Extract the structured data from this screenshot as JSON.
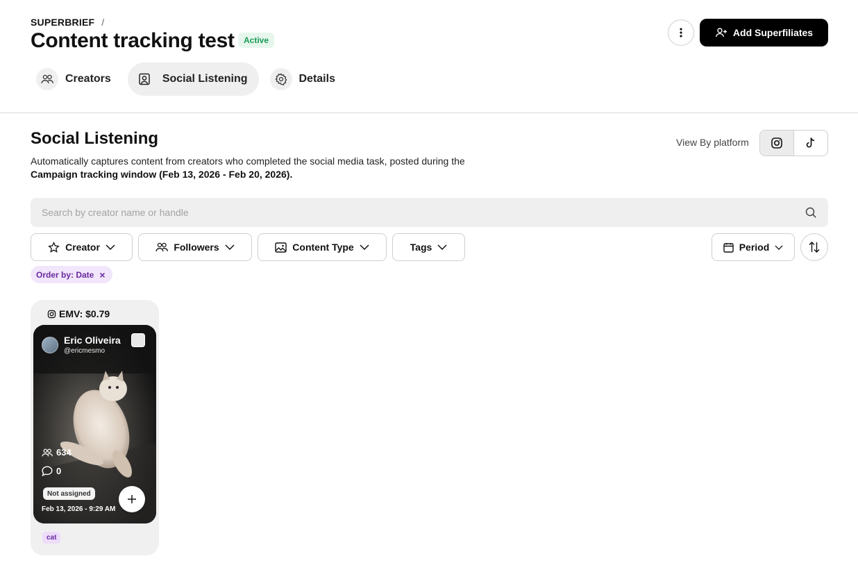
{
  "header": {
    "breadcrumb_root": "SUPERBRIEF",
    "breadcrumb_sep": "/",
    "title": "Content tracking test",
    "status_badge": "Active",
    "add_button_label": "Add Superfiliates"
  },
  "tabs": [
    {
      "label": "Creators",
      "icon": "users-icon",
      "active": false
    },
    {
      "label": "Social Listening",
      "icon": "user-square-icon",
      "active": true
    },
    {
      "label": "Details",
      "icon": "gear-icon",
      "active": false
    }
  ],
  "section": {
    "title": "Social Listening",
    "description": "Automatically captures content from creators who completed the social media task, posted during the",
    "description_bold": "Campaign tracking window (Feb 13, 2026 - Feb 20, 2026).",
    "view_by_label": "View By platform",
    "platforms": [
      {
        "name": "instagram-icon",
        "selected": true
      },
      {
        "name": "tiktok-icon",
        "selected": false
      }
    ]
  },
  "search": {
    "placeholder": "Search by creator name or handle",
    "value": ""
  },
  "filters": {
    "creator": "Creator",
    "followers": "Followers",
    "content_type": "Content Type",
    "tags": "Tags",
    "period": "Period"
  },
  "active_chips": {
    "order_by": "Order by: Date",
    "remove": "×"
  },
  "posts": [
    {
      "emv": "EMV: $0.79",
      "platform_icon": "instagram-icon",
      "creator_name": "Eric Oliveira",
      "creator_handle": "@ericmesmo",
      "followers": "634",
      "comments": "0",
      "assignment_status": "Not assigned",
      "posted_at": "Feb 13, 2026 - 9:29 AM",
      "tag": "cat"
    }
  ],
  "colors": {
    "primary": "#000000",
    "active_badge_bg": "#e6f6ec",
    "active_badge_text": "#1a9a55",
    "chip_bg": "#f1e6fb",
    "chip_text": "#6a2aa0"
  }
}
